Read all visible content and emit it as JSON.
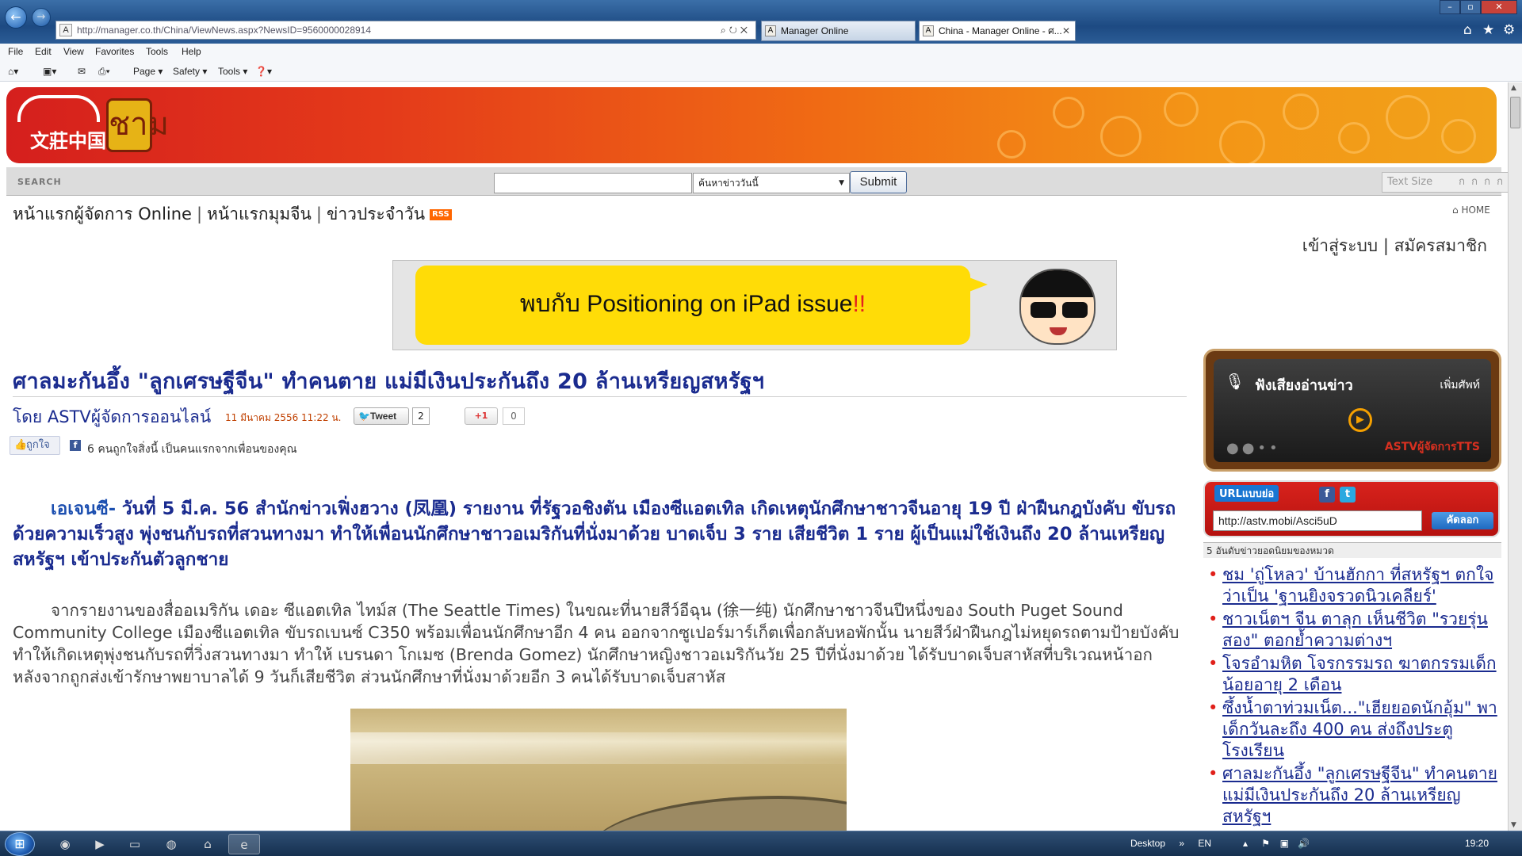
{
  "browser": {
    "address": "http://manager.co.th/China/ViewNews.aspx?NewsID=9560000028914",
    "tabs": [
      {
        "label": "Manager Online"
      },
      {
        "label": "China - Manager Online - ศ..."
      }
    ],
    "window_controls": [
      "–",
      "▫",
      "✕"
    ]
  },
  "menu": [
    "File",
    "Edit",
    "View",
    "Favorites",
    "Tools",
    "Help"
  ],
  "command_bar": {
    "page": "Page ▾",
    "safety": "Safety ▾",
    "tools": "Tools ▾"
  },
  "site": {
    "logo_text": "文莊中国",
    "stamp_text": "ชาม",
    "search_label": "SEARCH",
    "search_select": "ค้นหาข่าววันนี้",
    "submit_label": "Submit",
    "text_size_label": "Text Size",
    "text_size_options": "ก ก ก ก",
    "nav": [
      "หน้าแรกผู้จัดการ Online",
      "หน้าแรกมุมจีน",
      "ข่าวประจำวัน"
    ],
    "rss": "RSS",
    "home": "HOME",
    "login": "เข้าสู่ระบบ",
    "register": "สมัครสมาชิก"
  },
  "ad": {
    "text_main": "พบกับ Positioning on iPad issue",
    "text_red": "!!"
  },
  "article": {
    "headline": "ศาลมะกันอึ้ง \"ลูกเศรษฐีจีน\" ทำคนตาย แม่มีเงินประกันถึง 20 ล้านเหรียญสหรัฐฯ",
    "byline": "โดย ASTVผู้จัดการออนไลน์",
    "date": "11 มีนาคม 2556 11:22 น.",
    "tweet_label": "Tweet",
    "tweet_count": "2",
    "gplus_label": "+1",
    "gplus_count": "0",
    "like_label": "ถูกใจ",
    "like_text": "6 คนถูกใจสิ่งนี้ เป็นคนแรกจากเพื่อนของคุณ",
    "lead_source": "เอเจนซี-",
    "lead": " วันที่ 5 มี.ค. 56 สำนักข่าวเฟิ่งฮวาง (凤凰) รายงาน ที่รัฐวอชิงตัน เมืองซีแอตเทิล เกิดเหตุนักศึกษาชาวจีนอายุ 19 ปี ฝ่าฝืนกฎบังคับ ขับรถด้วยความเร็วสูง พุ่งชนกับรถที่สวนทางมา ทำให้เพื่อนนักศึกษาชาวอเมริกันที่นั่งมาด้วย บาดเจ็บ 3 ราย เสียชีวิต 1 ราย ผู้เป็นแม่ใช้เงินถึง 20 ล้านเหรียญสหรัฐฯ เข้าประกันตัวลูกชาย",
    "body": "จากรายงานของสื่ออเมริกัน เดอะ ซีแอตเทิล ไทม์ส (The Seattle Times) ในขณะที่นายสีว์อีฉุน (徐一纯) นักศึกษาชาวจีนปีหนึ่งของ South Puget Sound Community College เมืองซีแอตเทิล ขับรถเบนซ์ C350 พร้อมเพื่อนนักศึกษาอีก 4 คน ออกจากซูเปอร์มาร์เก็ตเพื่อกลับหอพักนั้น นายสีว์ฝ่าฝืนกฎไม่หยุดรถตามป้ายบังคับทำให้เกิดเหตุพุ่งชนกับรถที่วิ่งสวนทางมา ทำให้ เบรนดา โกเมซ (Brenda Gomez) นักศึกษาหญิงชาวอเมริกันวัย 25 ปีที่นั่งมาด้วย ได้รับบาดเจ็บสาหัสที่บริเวณหน้าอก หลังจากถูกส่งเข้ารักษาพยาบาลได้ 9 วันก็เสียชีวิต ส่วนนักศึกษาที่นั่งมาด้วยอีก 3 คนได้รับบาดเจ็บสาหัส"
  },
  "sidebar": {
    "radio_title": "ฟังเสียงอ่านข่าว",
    "radio_more": "เพิ่มศัพท์",
    "radio_brand": "ASTVผู้จัดการTTS",
    "url_head": "URLแบบย่อ",
    "short_url": "http://astv.mobi/Asci5uD",
    "copy_label": "คัดลอก",
    "top_header": "5 อันดับข่าวยอดนิยมของหมวด",
    "top_news": [
      "ชม 'ถู่โหลว' บ้านฮักกา ที่สหรัฐฯ ตกใจ ว่าเป็น 'ฐานยิงจรวดนิวเคลียร์'",
      "ชาวเน็ตฯ จีน ตาลุก เห็นชีวิต \"รวยรุ่นสอง\" ตอกย้ำความต่างฯ",
      "โจรอำมหิต โจรกรรมรถ ฆาตกรรมเด็กน้อยอายุ 2 เดือน",
      "ซึ้งน้ำตาท่วมเน็ต...\"เฮียยอดนักอุ้ม\" พาเด็กวันละถึง 400 คน ส่งถึงประตูโรงเรียน",
      "ศาลมะกันอึ้ง \"ลูกเศรษฐีจีน\" ทำคนตาย แม่มีเงินประกันถึง 20 ล้านเหรียญสหรัฐฯ"
    ]
  },
  "taskbar": {
    "desktop": "Desktop",
    "lang": "EN",
    "time": "19:20"
  },
  "colors": {
    "headline": "#1a2b8f",
    "banner_start": "#d51f1d",
    "banner_end": "#f2a21a",
    "ad_yellow": "#ffdc07",
    "bullet_red": "#e0201a"
  }
}
